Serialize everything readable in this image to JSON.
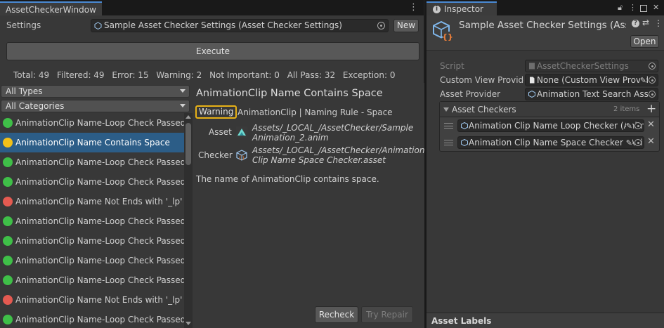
{
  "left_window": {
    "tab_title": "AssetCheckerWindow",
    "settings_label": "Settings",
    "settings_value": "Sample Asset Checker Settings (Asset Checker Settings)",
    "new_button": "New",
    "execute_button": "Execute",
    "summary": {
      "total": "Total: 49",
      "filtered": "Filtered: 49",
      "error": "Error: 15",
      "warning": "Warning: 2",
      "not_important": "Not Important: 0",
      "all_pass": "All Pass: 32",
      "exception": "Exception: 0"
    },
    "types_filter": "All Types",
    "categories_filter": "All Categories",
    "results": [
      {
        "label": "AnimationClip Name-Loop Check Passed",
        "status": "green"
      },
      {
        "label": "AnimationClip Name Contains Space",
        "status": "yellow"
      },
      {
        "label": "AnimationClip Name-Loop Check Passed",
        "status": "green"
      },
      {
        "label": "AnimationClip Name-Loop Check Passed",
        "status": "green"
      },
      {
        "label": "AnimationClip Name Not Ends with '_lp'",
        "status": "red"
      },
      {
        "label": "AnimationClip Name-Loop Check Passed",
        "status": "green"
      },
      {
        "label": "AnimationClip Name-Loop Check Passed",
        "status": "green"
      },
      {
        "label": "AnimationClip Name-Loop Check Passed",
        "status": "green"
      },
      {
        "label": "AnimationClip Name-Loop Check Passed",
        "status": "green"
      },
      {
        "label": "AnimationClip Name Not Ends with '_lp'",
        "status": "red"
      },
      {
        "label": "AnimationClip Name-Loop Check Passed",
        "status": "green"
      }
    ],
    "detail": {
      "title": "AnimationClip Name Contains Space",
      "badge": "Warning",
      "subtitle": "AnimationClip | Naming Rule - Space",
      "asset_label": "Asset",
      "asset_path": "Assets/_LOCAL_/AssetChecker/Sample Animation_2.anim",
      "checker_label": "Checker",
      "checker_path": "Assets/_LOCAL_/AssetChecker/Animation Clip Name Space Checker.asset",
      "description": "The name of AnimationClip contains space.",
      "recheck_button": "Recheck",
      "repair_button": "Try Repair"
    }
  },
  "inspector": {
    "tab_title": "Inspector",
    "object_title": "Sample Asset Checker Settings (Asse",
    "open_button": "Open",
    "script_label": "Script",
    "script_value": "AssetCheckerSettings",
    "custom_view_label": "Custom View Provide",
    "custom_view_value": "None (Custom View Provide",
    "asset_provider_label": "Asset Provider",
    "asset_provider_value": "Animation Text Search Asse",
    "checkers_label": "Asset Checkers",
    "checkers_count": "2 items",
    "checkers": [
      "Animation Clip Name Loop Checker (Anim",
      "Animation Clip Name Space Checker (Ani"
    ],
    "asset_labels": "Asset Labels"
  },
  "colors": {
    "accent": "#4a8ad4",
    "selection": "#2c5d87",
    "pass": "#3fbf48",
    "warning": "#f2c018",
    "error": "#e45a51"
  }
}
